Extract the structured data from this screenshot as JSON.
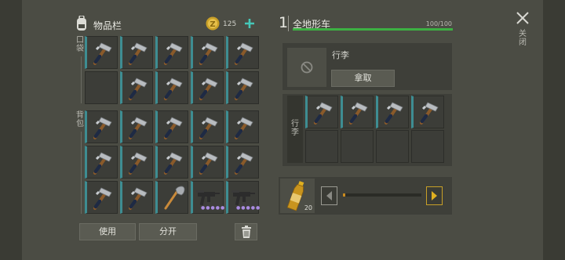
{
  "inventory": {
    "title": "物品栏",
    "coin_count": "125",
    "pocket_label": "口袋",
    "backpack_label": "背包",
    "use_button": "使用",
    "split_button": "分开",
    "slots": [
      "hammer",
      "hammer",
      "hammer",
      "hammer",
      "hammer",
      "empty",
      "hammer",
      "hammer",
      "hammer",
      "hammer",
      "hammer",
      "hammer",
      "hammer",
      "hammer",
      "hammer",
      "hammer",
      "hammer",
      "hammer",
      "hammer",
      "hammer",
      "hammer",
      "hammer",
      "shovel",
      "smg",
      "smg"
    ]
  },
  "vehicle": {
    "index": "1",
    "name": "全地形车",
    "capacity": "100/100",
    "capacity_fraction": 1.0,
    "luggage_label": "行李",
    "take_button": "拿取",
    "trunk_label": "行李",
    "trunk_slots": [
      "hammer",
      "hammer",
      "hammer",
      "hammer",
      "empty",
      "empty",
      "empty",
      "empty"
    ]
  },
  "fuel": {
    "count": "20",
    "slider_fraction": 0.03
  },
  "close_label": "关闭",
  "colors": {
    "accent_green": "#3cb043",
    "teal": "#3e8d92",
    "gold": "#c8a028"
  }
}
